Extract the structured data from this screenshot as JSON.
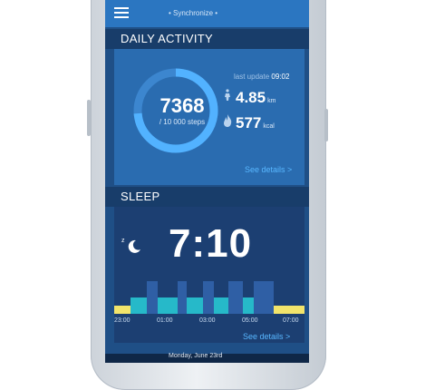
{
  "header": {
    "sync_label": "• Synchronize •"
  },
  "daily_activity": {
    "title": "DAILY ACTIVITY",
    "steps": "7368",
    "goal_label": "/ 10 000 steps",
    "progress": 0.7368,
    "last_update_label": "last update",
    "last_update_time": "09:02",
    "distance_value": "4.85",
    "distance_unit": "km",
    "calories_value": "577",
    "calories_unit": "kcal",
    "see_details": "See details >"
  },
  "sleep": {
    "title": "SLEEP",
    "duration": "7:10",
    "ticks": [
      "23:00",
      "01:00",
      "03:00",
      "05:00",
      "07:00"
    ],
    "see_details": "See details >"
  },
  "footer": {
    "date_label": "Monday, June 23rd"
  },
  "colors": {
    "screen_bg": "#1f4f86",
    "accent": "#58b7ff",
    "ring_progress": "#52b2ff",
    "light_sleep": "#26b9c9",
    "deep_sleep": "#2f5fa5",
    "awake": "#f2e46b"
  }
}
